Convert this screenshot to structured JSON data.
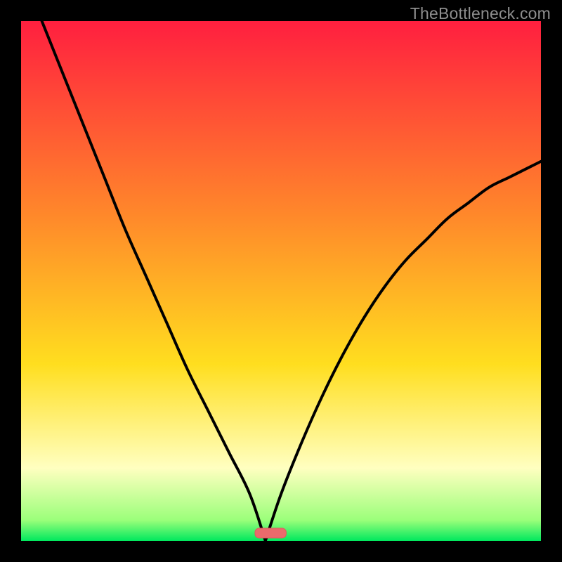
{
  "watermark": "TheBottleneck.com",
  "colors": {
    "frame": "#000000",
    "curve": "#000000",
    "marker_fill": "#ea6a6c",
    "marker_stroke": "#e1595c",
    "grad_top": "#ff1f3f",
    "grad_mid_upper": "#ff8a2a",
    "grad_mid": "#ffde1f",
    "grad_band": "#ffffc0",
    "grad_lower": "#9bff7a",
    "grad_bottom": "#00e85e"
  },
  "chart_data": {
    "type": "line",
    "title": "",
    "xlabel": "",
    "ylabel": "",
    "xlim": [
      0,
      100
    ],
    "ylim": [
      0,
      100
    ],
    "grid": false,
    "legend": false,
    "minimum_x": 47,
    "marker": {
      "x_start": 45,
      "x_end": 51,
      "y": 1.5
    },
    "series": [
      {
        "name": "left-branch",
        "x": [
          4,
          8,
          12,
          16,
          20,
          24,
          28,
          32,
          36,
          40,
          44,
          47
        ],
        "y": [
          100,
          90,
          80,
          70,
          60,
          51,
          42,
          33,
          25,
          17,
          9,
          0
        ]
      },
      {
        "name": "right-branch",
        "x": [
          47,
          50,
          54,
          58,
          62,
          66,
          70,
          74,
          78,
          82,
          86,
          90,
          94,
          98,
          100
        ],
        "y": [
          0,
          9,
          19,
          28,
          36,
          43,
          49,
          54,
          58,
          62,
          65,
          68,
          70,
          72,
          73
        ]
      }
    ]
  }
}
